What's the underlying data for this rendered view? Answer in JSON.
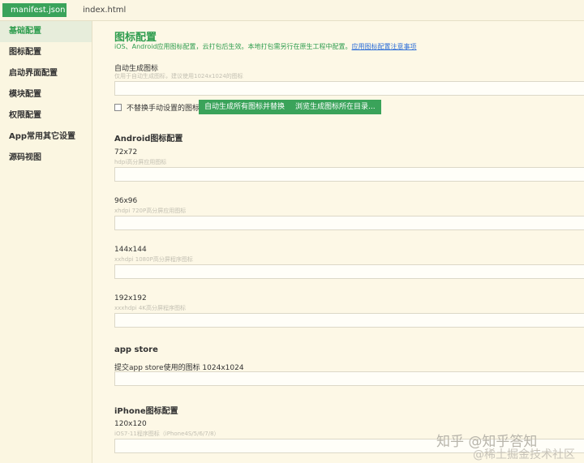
{
  "tabs": [
    {
      "label": "manifest.json"
    },
    {
      "label": "index.html"
    }
  ],
  "sidebar": {
    "items": [
      {
        "label": "基础配置"
      },
      {
        "label": "图标配置"
      },
      {
        "label": "启动界面配置"
      },
      {
        "label": "模块配置"
      },
      {
        "label": "权限配置"
      },
      {
        "label": "App常用其它设置"
      },
      {
        "label": "源码视图"
      }
    ]
  },
  "main": {
    "title": "图标配置",
    "description": "iOS、Android应用图标配置，云打包后生效。本地打包需另行在原生工程中配置。",
    "description_link": "应用图标配置注意事项",
    "auto": {
      "label": "自动生成图标",
      "hint": "仅用于自动生成图标，建议使用1024x1024的图标",
      "checkbox_label": "不替换手动设置的图标",
      "btn_generate": "自动生成所有图标并替换",
      "btn_browse": "浏览生成图标所在目录..."
    },
    "android": {
      "title": "Android图标配置",
      "icons": [
        {
          "label": "72x72",
          "hint": "hdpi高分屏应用图标"
        },
        {
          "label": "96x96",
          "hint": "xhdpi 720P高分屏应用图标"
        },
        {
          "label": "144x144",
          "hint": "xxhdpi 1080P高分屏程序图标"
        },
        {
          "label": "192x192",
          "hint": "xxxhdpi 4K高分屏程序图标"
        }
      ]
    },
    "appstore": {
      "title": "app store",
      "label": "提交app store使用的图标 1024x1024"
    },
    "iphone": {
      "title": "iPhone图标配置",
      "icons": [
        {
          "label": "120x120",
          "hint": "iOS7-11程序图标（iPhone4S/5/6/7/8）"
        }
      ]
    }
  },
  "watermark": {
    "line1": "知乎 @知乎答知",
    "line2": "@稀土掘金技术社区"
  }
}
